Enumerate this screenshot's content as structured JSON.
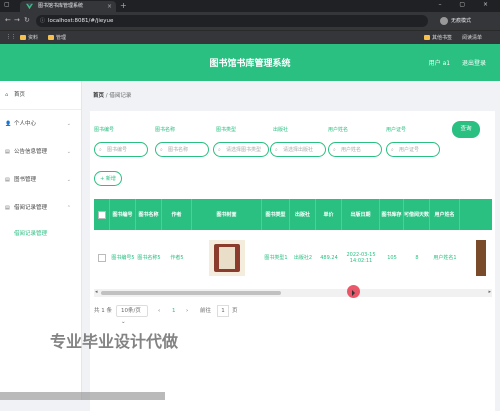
{
  "browser": {
    "tab_title": "图书馆书库管理系统",
    "url": "localhost:8081/#/jieyue",
    "profile_name": "无痕模式",
    "bookmarks": [
      "资料",
      "管理"
    ],
    "bookmarks_right": [
      "其他书签",
      "阅读清单"
    ]
  },
  "header": {
    "title": "图书馆书库管理系统",
    "user_label": "用户 a1",
    "logout_label": "退出登录"
  },
  "sidebar": {
    "items": [
      {
        "label": "首页",
        "icon": "home-icon"
      },
      {
        "label": "个人中心",
        "icon": "user-icon"
      },
      {
        "label": "公告信息管理",
        "icon": "notice-icon"
      },
      {
        "label": "图书管理",
        "icon": "book-icon"
      },
      {
        "label": "借阅记录管理",
        "icon": "record-icon"
      }
    ],
    "submenu": {
      "label": "借阅记录管理"
    }
  },
  "breadcrumb": {
    "home": "首页",
    "separator": "/",
    "current": "借阅记录"
  },
  "filters": [
    {
      "label": "图书编号",
      "placeholder": "图书编号"
    },
    {
      "label": "图书名称",
      "placeholder": "图书名称"
    },
    {
      "label": "图书类型",
      "placeholder": "请选择图书类型"
    },
    {
      "label": "出版社",
      "placeholder": "请选择出版社"
    },
    {
      "label": "用户姓名",
      "placeholder": "用户姓名"
    },
    {
      "label": "用户证号",
      "placeholder": "用户证号"
    }
  ],
  "buttons": {
    "query": "查询",
    "add": "+ 新增"
  },
  "table": {
    "headers": [
      "图书编号",
      "图书名称",
      "作者",
      "图书封面",
      "图书类型",
      "出版社",
      "单价",
      "出版日期",
      "图书库存",
      "可借阅天数",
      "用户姓名"
    ],
    "rows": [
      {
        "book_no": "图书编号5",
        "book_name": "图书名称5",
        "author": "作者5",
        "type": "图书类型1",
        "publisher": "出版社2",
        "price": "489.24",
        "pub_date": "2022-03-15 14:02:11",
        "stock": "105",
        "days": "8",
        "user": "用户姓名1"
      }
    ]
  },
  "pagination": {
    "total": "共 1 条",
    "page_size": "10条/页",
    "prev": "‹",
    "page": "1",
    "next": "›",
    "goto_label": "前往",
    "goto_value": "1",
    "page_unit": "页"
  },
  "watermark": "专业毕业设计代做",
  "colors": {
    "primary": "#29c081",
    "browser_dark": "#202124"
  }
}
